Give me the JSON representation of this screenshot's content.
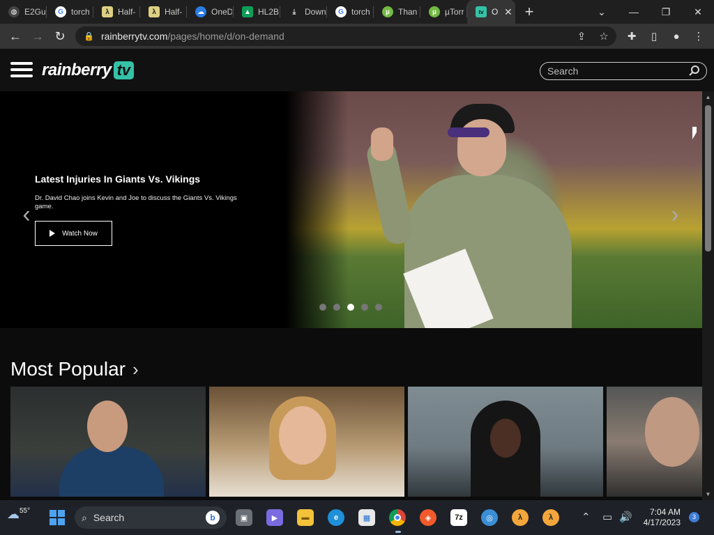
{
  "browser": {
    "tabs": [
      {
        "title": "E2Gu",
        "icon": "globe-icon",
        "color": "#3a3a3a"
      },
      {
        "title": "torch",
        "icon": "google-icon",
        "color": "#ffffff"
      },
      {
        "title": "Half-",
        "icon": "half-life-icon",
        "color": "#ddd082"
      },
      {
        "title": "Half-",
        "icon": "half-life-icon",
        "color": "#ddd082"
      },
      {
        "title": "OneD",
        "icon": "onedrive-icon",
        "color": "#2a7de1"
      },
      {
        "title": "HL2B",
        "icon": "google-drive-icon",
        "color": "#f4b400"
      },
      {
        "title": "Down",
        "icon": "download-icon",
        "color": "#dddddd"
      },
      {
        "title": "torch",
        "icon": "google-icon",
        "color": "#ffffff"
      },
      {
        "title": "Than",
        "icon": "utorrent-icon",
        "color": "#74b943"
      },
      {
        "title": "µTorr",
        "icon": "utorrent-icon",
        "color": "#74b943"
      },
      {
        "title": "O",
        "icon": "rainberry-icon",
        "color": "#34c2a7"
      }
    ],
    "url_host": "rainberrytv.com",
    "url_path": "/pages/home/d/on-demand"
  },
  "site": {
    "logo_word": "rainberry",
    "logo_tv": "tv",
    "search_placeholder": "Search"
  },
  "hero": {
    "title": "Latest Injuries In Giants Vs. Vikings",
    "description": "Dr. David Chao joins Kevin and Joe to discuss the Giants Vs. Vikings game.",
    "button_label": "Watch Now",
    "slide_count": 5,
    "active_slide": 3
  },
  "most_popular": {
    "title": "Most Popular"
  },
  "taskbar": {
    "weather_temp": "55°",
    "search_label": "Search",
    "time": "7:04 AM",
    "date": "4/17/2023",
    "notification_count": "3"
  }
}
